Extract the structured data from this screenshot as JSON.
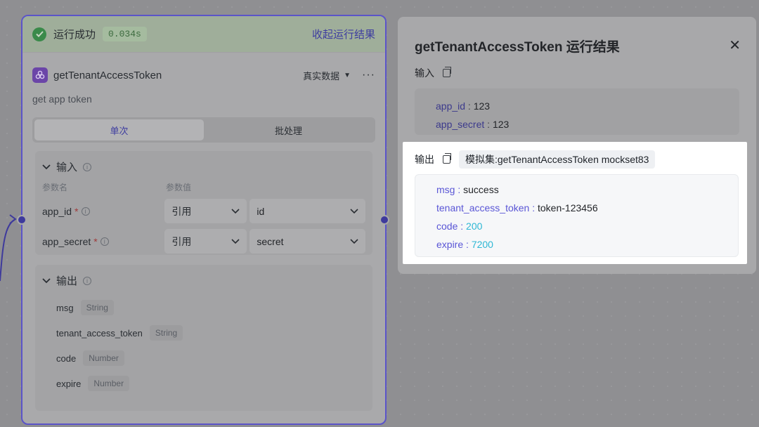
{
  "node": {
    "run_status": "运行成功",
    "run_time": "0.034s",
    "collapse_label": "收起运行结果",
    "title": "getTenantAccessToken",
    "data_mode": "真实数据",
    "description": "get app token",
    "tabs": [
      {
        "label": "单次",
        "active": true
      },
      {
        "label": "批处理",
        "active": false
      }
    ],
    "input_section": {
      "title": "输入",
      "col_name": "参数名",
      "col_value": "参数值",
      "params": [
        {
          "name": "app_id",
          "required": "*",
          "ref": "引用",
          "value": "id"
        },
        {
          "name": "app_secret",
          "required": "*",
          "ref": "引用",
          "value": "secret"
        }
      ]
    },
    "output_section": {
      "title": "输出",
      "fields": [
        {
          "name": "msg",
          "type": "String"
        },
        {
          "name": "tenant_access_token",
          "type": "String"
        },
        {
          "name": "code",
          "type": "Number"
        },
        {
          "name": "expire",
          "type": "Number"
        }
      ]
    }
  },
  "result": {
    "title": "getTenantAccessToken 运行结果",
    "input_label": "输入",
    "inputs": [
      {
        "key": "app_id",
        "value": "123"
      },
      {
        "key": "app_secret",
        "value": "123"
      }
    ],
    "output_label": "输出",
    "mockset_badge": "模拟集:getTenantAccessToken mockset83",
    "outputs": [
      {
        "key": "msg",
        "value": "success",
        "numeric": false
      },
      {
        "key": "tenant_access_token",
        "value": "token-123456",
        "numeric": false
      },
      {
        "key": "code",
        "value": "200",
        "numeric": true
      },
      {
        "key": "expire",
        "value": "7200",
        "numeric": true
      }
    ]
  },
  "colors": {
    "accent": "#4e4bd3",
    "success": "#34a853",
    "number_value": "#2db7d4"
  }
}
